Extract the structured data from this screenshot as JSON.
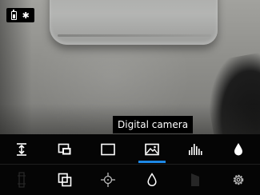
{
  "tooltip": {
    "text": "Digital camera"
  },
  "status": {
    "icons": [
      "battery-icon",
      "bluetooth-icon"
    ],
    "bluetooth_glyph": "✱"
  },
  "toolbar": {
    "accent_color": "#1e88e5",
    "row1": [
      {
        "icon": "level-span-icon",
        "active": false
      },
      {
        "icon": "picture-in-picture-icon",
        "active": false
      },
      {
        "icon": "full-screen-thermal-icon",
        "active": false
      },
      {
        "icon": "digital-camera-icon",
        "active": true
      },
      {
        "icon": "histogram-icon",
        "active": false
      },
      {
        "icon": "droplet-icon",
        "active": false
      }
    ],
    "row2": [
      {
        "icon": "level-bar-disabled-icon",
        "enabled": false
      },
      {
        "icon": "overlay-icon",
        "enabled": true
      },
      {
        "icon": "spot-meter-icon",
        "enabled": true
      },
      {
        "icon": "dew-point-icon",
        "enabled": true
      },
      {
        "icon": "gradient-disabled-icon",
        "enabled": false
      },
      {
        "icon": "settings-gear-icon",
        "enabled": true
      }
    ]
  }
}
